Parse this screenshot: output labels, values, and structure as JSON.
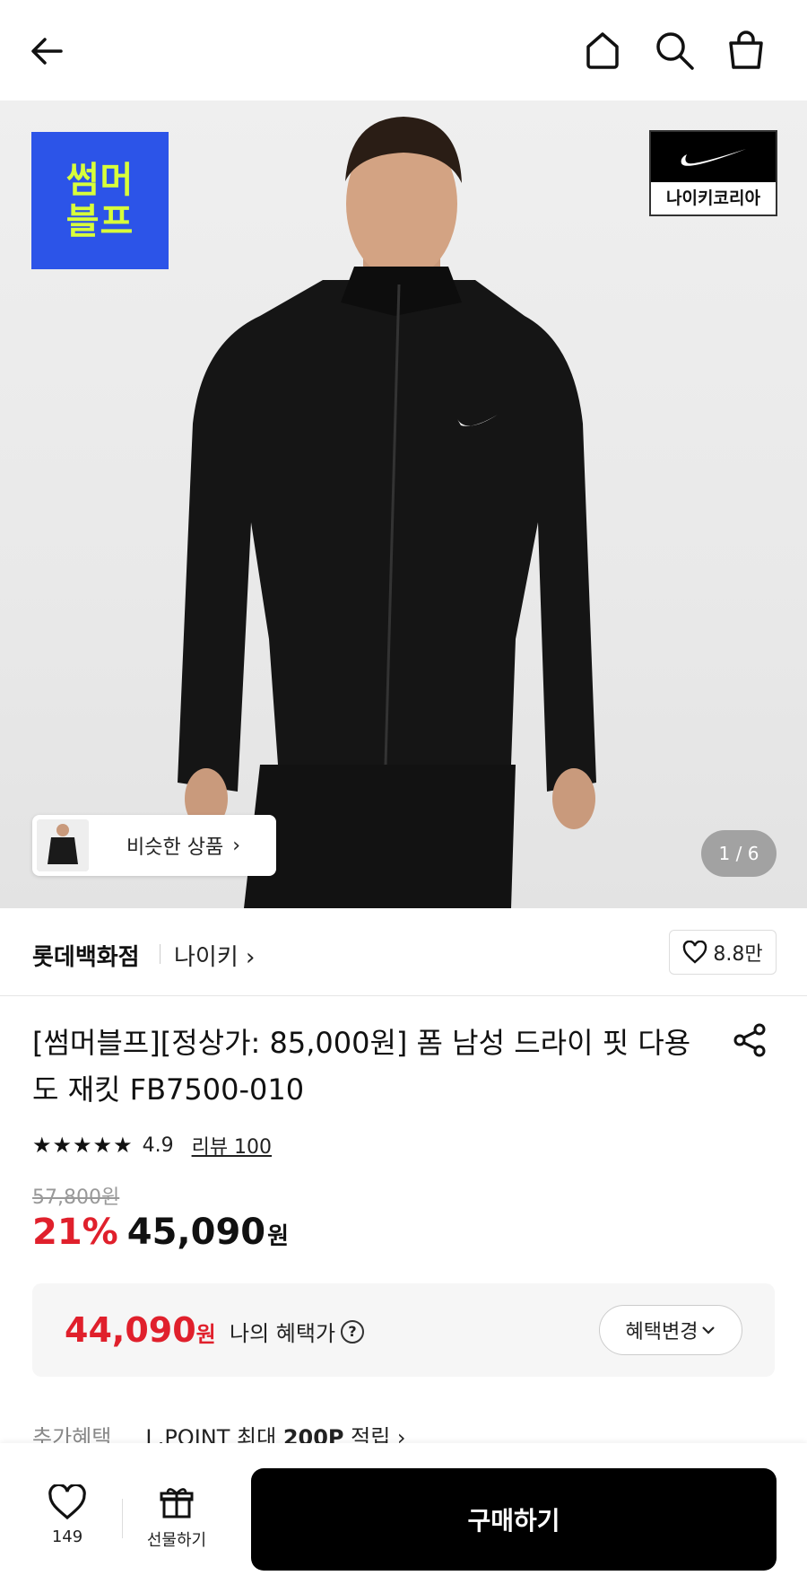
{
  "header": {
    "back_icon": "arrow-left-icon",
    "home_icon": "home-icon",
    "search_icon": "search-icon",
    "cart_icon": "shopping-bag-icon"
  },
  "hero": {
    "promo_badge": {
      "line1": "썸머",
      "line2": "블프",
      "bg": "#2c54e8",
      "fg": "#d8ff3a"
    },
    "brand_badge_text": "나이키코리아",
    "similar_label": "비슷한 상품",
    "pager": "1 / 6"
  },
  "store": {
    "name": "롯데백화점",
    "brand": "나이키",
    "likes": "8.8만"
  },
  "product": {
    "title": "[썸머블프][정상가: 85,000원] 폼 남성 드라이 핏 다용도 재킷 FB7500-010",
    "stars": "★★★★★",
    "rating": "4.9",
    "review_link": "리뷰 100",
    "original_price": "57,800원",
    "discount": "21%",
    "sale_price": "45,090",
    "currency": "원"
  },
  "benefit": {
    "price": "44,090",
    "currency": "원",
    "label": "나의 혜택가",
    "change_button": "혜택변경",
    "accent_color": "#e0202c"
  },
  "extra_benefit": {
    "label": "추가혜택",
    "value_prefix": "L.POINT 최대 ",
    "value_bold": "200P",
    "value_suffix": " 적립"
  },
  "bottom_bar": {
    "wish_count": "149",
    "gift_label": "선물하기",
    "buy_label": "구매하기"
  }
}
